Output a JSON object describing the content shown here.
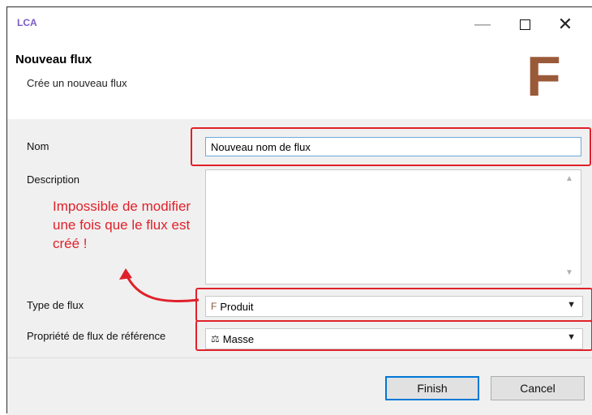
{
  "titlebar": {
    "app_logo": "LCA",
    "minimize": "—",
    "close": "✕"
  },
  "header": {
    "title": "Nouveau flux",
    "subtitle": "Crée un nouveau flux",
    "big_letter": "F"
  },
  "form": {
    "nom_label": "Nom",
    "nom_value": "Nouveau nom de flux",
    "description_label": "Description",
    "description_value": "",
    "type_label": "Type de flux",
    "type_value": "Produit",
    "type_icon": "flow-product-icon",
    "property_label": "Propriété de flux de référence",
    "property_value": "Masse",
    "property_icon": "scale-icon"
  },
  "annotation": {
    "note": "Impossible de modifier une fois que le flux est créé !",
    "color": "#e0212a"
  },
  "footer": {
    "finish_label": "Finish",
    "cancel_label": "Cancel"
  }
}
